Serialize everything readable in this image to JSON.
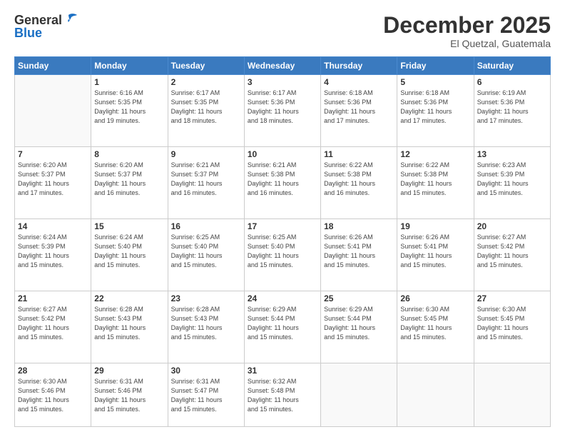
{
  "header": {
    "logo_general": "General",
    "logo_blue": "Blue",
    "month": "December 2025",
    "location": "El Quetzal, Guatemala"
  },
  "weekdays": [
    "Sunday",
    "Monday",
    "Tuesday",
    "Wednesday",
    "Thursday",
    "Friday",
    "Saturday"
  ],
  "weeks": [
    [
      {
        "day": "",
        "info": ""
      },
      {
        "day": "1",
        "info": "Sunrise: 6:16 AM\nSunset: 5:35 PM\nDaylight: 11 hours\nand 19 minutes."
      },
      {
        "day": "2",
        "info": "Sunrise: 6:17 AM\nSunset: 5:35 PM\nDaylight: 11 hours\nand 18 minutes."
      },
      {
        "day": "3",
        "info": "Sunrise: 6:17 AM\nSunset: 5:36 PM\nDaylight: 11 hours\nand 18 minutes."
      },
      {
        "day": "4",
        "info": "Sunrise: 6:18 AM\nSunset: 5:36 PM\nDaylight: 11 hours\nand 17 minutes."
      },
      {
        "day": "5",
        "info": "Sunrise: 6:18 AM\nSunset: 5:36 PM\nDaylight: 11 hours\nand 17 minutes."
      },
      {
        "day": "6",
        "info": "Sunrise: 6:19 AM\nSunset: 5:36 PM\nDaylight: 11 hours\nand 17 minutes."
      }
    ],
    [
      {
        "day": "7",
        "info": "Sunrise: 6:20 AM\nSunset: 5:37 PM\nDaylight: 11 hours\nand 17 minutes."
      },
      {
        "day": "8",
        "info": "Sunrise: 6:20 AM\nSunset: 5:37 PM\nDaylight: 11 hours\nand 16 minutes."
      },
      {
        "day": "9",
        "info": "Sunrise: 6:21 AM\nSunset: 5:37 PM\nDaylight: 11 hours\nand 16 minutes."
      },
      {
        "day": "10",
        "info": "Sunrise: 6:21 AM\nSunset: 5:38 PM\nDaylight: 11 hours\nand 16 minutes."
      },
      {
        "day": "11",
        "info": "Sunrise: 6:22 AM\nSunset: 5:38 PM\nDaylight: 11 hours\nand 16 minutes."
      },
      {
        "day": "12",
        "info": "Sunrise: 6:22 AM\nSunset: 5:38 PM\nDaylight: 11 hours\nand 15 minutes."
      },
      {
        "day": "13",
        "info": "Sunrise: 6:23 AM\nSunset: 5:39 PM\nDaylight: 11 hours\nand 15 minutes."
      }
    ],
    [
      {
        "day": "14",
        "info": "Sunrise: 6:24 AM\nSunset: 5:39 PM\nDaylight: 11 hours\nand 15 minutes."
      },
      {
        "day": "15",
        "info": "Sunrise: 6:24 AM\nSunset: 5:40 PM\nDaylight: 11 hours\nand 15 minutes."
      },
      {
        "day": "16",
        "info": "Sunrise: 6:25 AM\nSunset: 5:40 PM\nDaylight: 11 hours\nand 15 minutes."
      },
      {
        "day": "17",
        "info": "Sunrise: 6:25 AM\nSunset: 5:40 PM\nDaylight: 11 hours\nand 15 minutes."
      },
      {
        "day": "18",
        "info": "Sunrise: 6:26 AM\nSunset: 5:41 PM\nDaylight: 11 hours\nand 15 minutes."
      },
      {
        "day": "19",
        "info": "Sunrise: 6:26 AM\nSunset: 5:41 PM\nDaylight: 11 hours\nand 15 minutes."
      },
      {
        "day": "20",
        "info": "Sunrise: 6:27 AM\nSunset: 5:42 PM\nDaylight: 11 hours\nand 15 minutes."
      }
    ],
    [
      {
        "day": "21",
        "info": "Sunrise: 6:27 AM\nSunset: 5:42 PM\nDaylight: 11 hours\nand 15 minutes."
      },
      {
        "day": "22",
        "info": "Sunrise: 6:28 AM\nSunset: 5:43 PM\nDaylight: 11 hours\nand 15 minutes."
      },
      {
        "day": "23",
        "info": "Sunrise: 6:28 AM\nSunset: 5:43 PM\nDaylight: 11 hours\nand 15 minutes."
      },
      {
        "day": "24",
        "info": "Sunrise: 6:29 AM\nSunset: 5:44 PM\nDaylight: 11 hours\nand 15 minutes."
      },
      {
        "day": "25",
        "info": "Sunrise: 6:29 AM\nSunset: 5:44 PM\nDaylight: 11 hours\nand 15 minutes."
      },
      {
        "day": "26",
        "info": "Sunrise: 6:30 AM\nSunset: 5:45 PM\nDaylight: 11 hours\nand 15 minutes."
      },
      {
        "day": "27",
        "info": "Sunrise: 6:30 AM\nSunset: 5:45 PM\nDaylight: 11 hours\nand 15 minutes."
      }
    ],
    [
      {
        "day": "28",
        "info": "Sunrise: 6:30 AM\nSunset: 5:46 PM\nDaylight: 11 hours\nand 15 minutes."
      },
      {
        "day": "29",
        "info": "Sunrise: 6:31 AM\nSunset: 5:46 PM\nDaylight: 11 hours\nand 15 minutes."
      },
      {
        "day": "30",
        "info": "Sunrise: 6:31 AM\nSunset: 5:47 PM\nDaylight: 11 hours\nand 15 minutes."
      },
      {
        "day": "31",
        "info": "Sunrise: 6:32 AM\nSunset: 5:48 PM\nDaylight: 11 hours\nand 15 minutes."
      },
      {
        "day": "",
        "info": ""
      },
      {
        "day": "",
        "info": ""
      },
      {
        "day": "",
        "info": ""
      }
    ]
  ]
}
